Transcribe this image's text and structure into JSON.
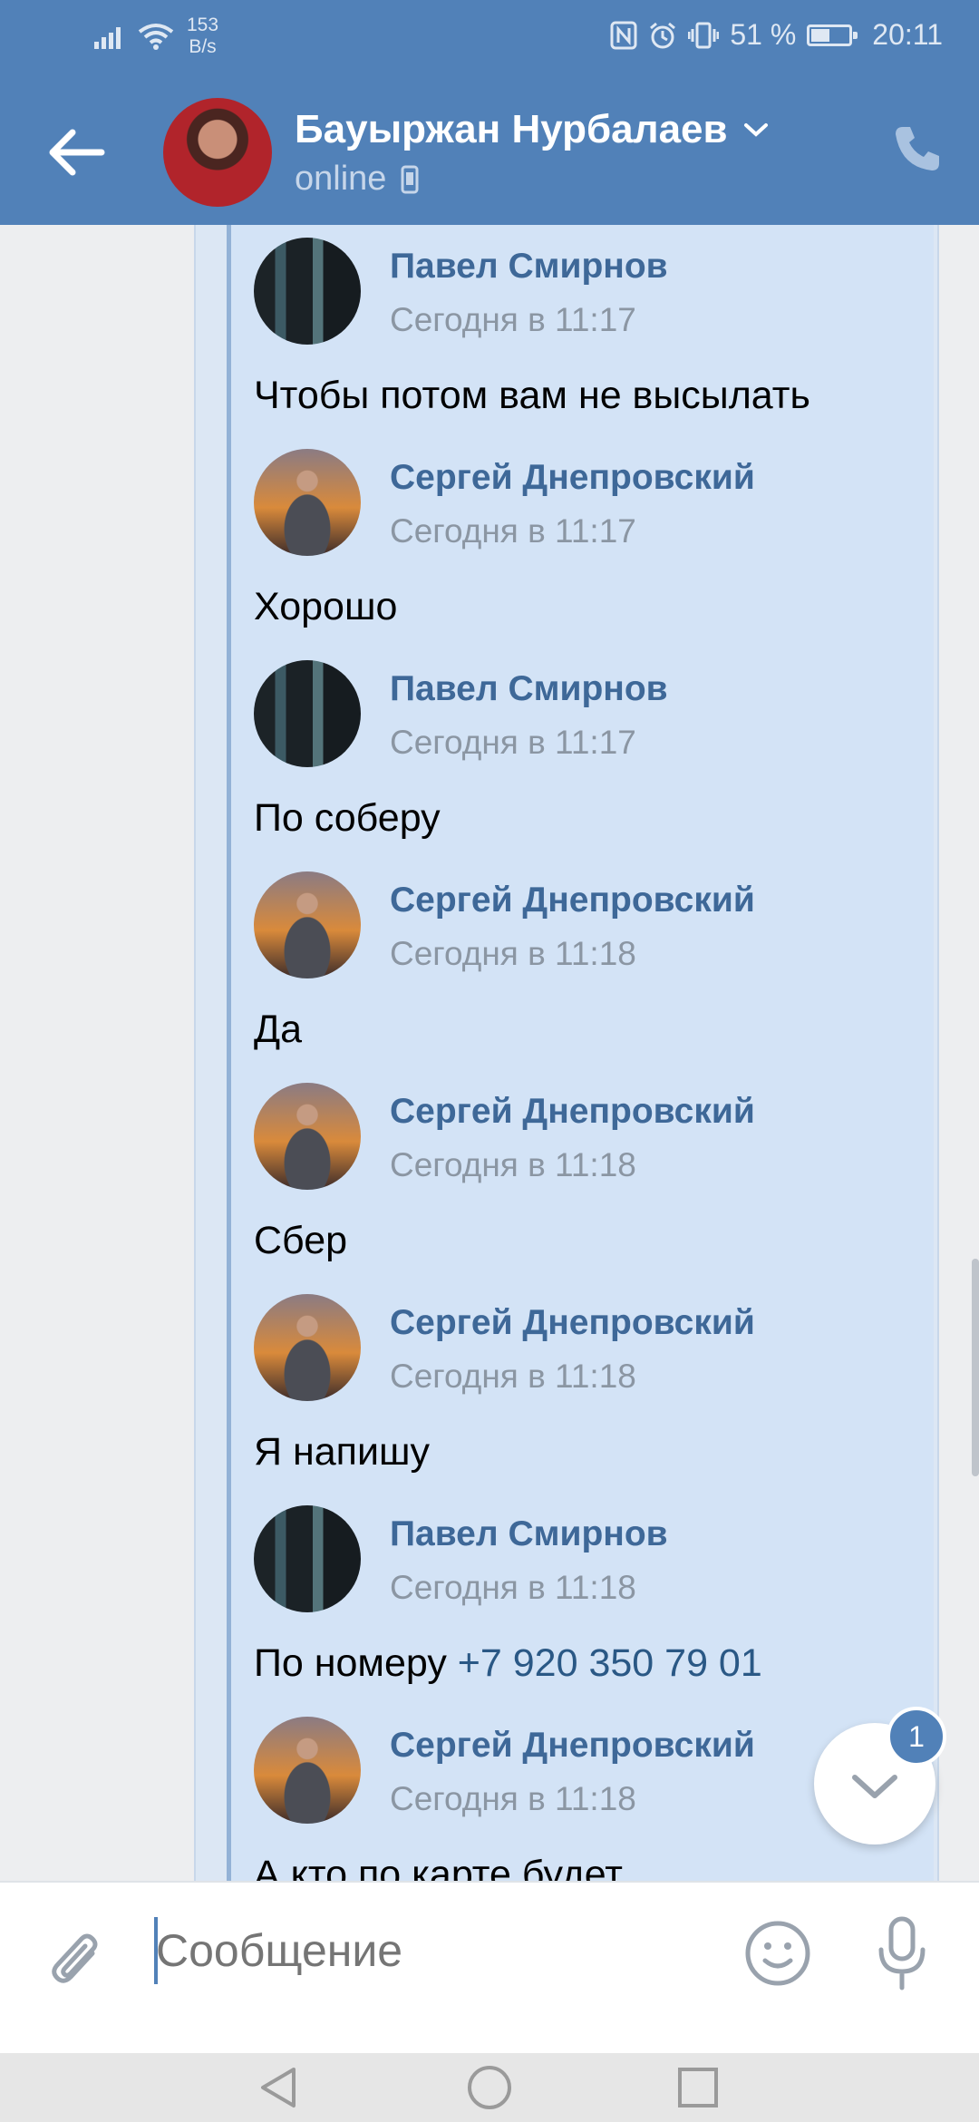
{
  "status_bar": {
    "net_speed_value": "153",
    "net_speed_unit": "B/s",
    "battery": "51 %",
    "battery_level": 0.51,
    "time": "20:11"
  },
  "header": {
    "name": "Бауыржан Нурбалаев",
    "status": "online",
    "icons": [
      "back-arrow-icon",
      "chevron-down-icon",
      "mobile-icon",
      "phone-icon"
    ]
  },
  "messages": [
    {
      "author": "Павел Смирнов",
      "time": "Сегодня в 11:17",
      "text": "Чтобы потом вам не высылать",
      "avatar": "pavel"
    },
    {
      "author": "Сергей Днепровский",
      "time": "Сегодня в 11:17",
      "text": "Хорошо",
      "avatar": "sergey"
    },
    {
      "author": "Павел Смирнов",
      "time": "Сегодня в 11:17",
      "text": "По соберу",
      "avatar": "pavel"
    },
    {
      "author": "Сергей Днепровский",
      "time": "Сегодня в 11:18",
      "text": "Да",
      "avatar": "sergey"
    },
    {
      "author": "Сергей Днепровский",
      "time": "Сегодня в 11:18",
      "text": "Сбер",
      "avatar": "sergey"
    },
    {
      "author": "Сергей Днепровский",
      "time": "Сегодня в 11:18",
      "text": "Я напишу",
      "avatar": "sergey"
    },
    {
      "author": "Павел Смирнов",
      "time": "Сегодня в 11:18",
      "text": "По номеру ",
      "link": "+7 920 350 79 01",
      "avatar": "pavel"
    },
    {
      "author": "Сергей Днепровский",
      "time": "Сегодня в 11:18",
      "text": "А кто по карте будет",
      "avatar": "sergey"
    }
  ],
  "scroll_down": {
    "badge": "1"
  },
  "composer": {
    "placeholder": "Сообщение"
  },
  "colors": {
    "header": "#5181b8",
    "accent": "#5181b8",
    "author": "#3e6898",
    "forward_bg": "#d3e3f6"
  }
}
